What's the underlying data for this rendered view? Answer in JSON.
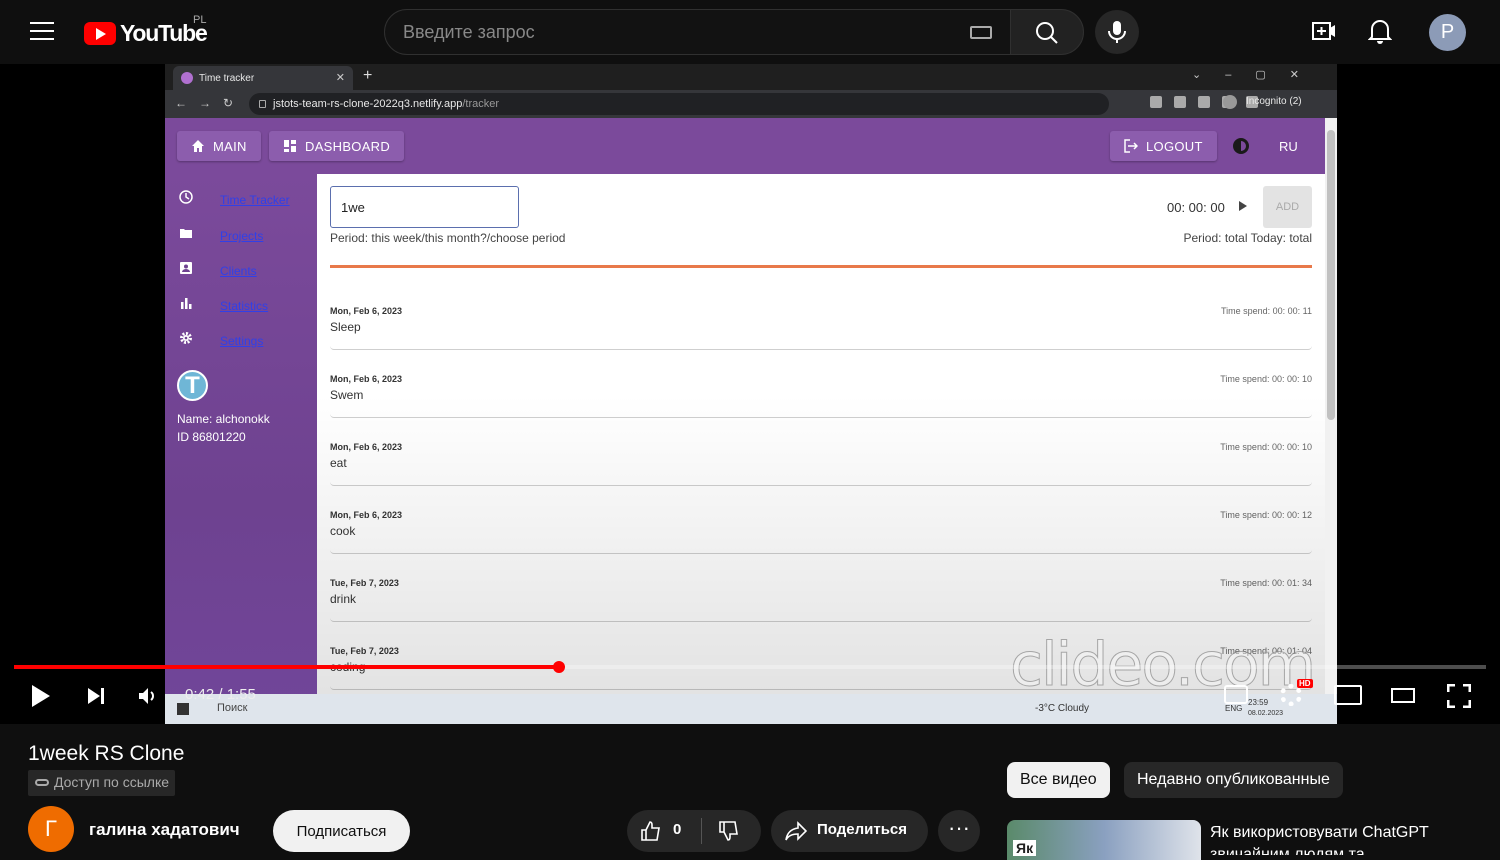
{
  "youtube": {
    "logo_text": "YouTube",
    "region": "PL",
    "search_placeholder": "Введите запрос",
    "avatar_letter": "P"
  },
  "browser": {
    "tab_title": "Time tracker",
    "tab_close": "✕",
    "new_tab": "+",
    "url_host": "jstots-team-rs-clone-2022q3.netlify.app",
    "url_path": "/tracker",
    "incognito": "Incognito (2)"
  },
  "app": {
    "nav": {
      "main": "MAIN",
      "dashboard": "DASHBOARD",
      "logout": "LOGOUT",
      "lang": "RU"
    },
    "sidebar": [
      {
        "label": "Time Tracker",
        "icon": "clock-icon"
      },
      {
        "label": "Projects",
        "icon": "folder-icon"
      },
      {
        "label": "Clients",
        "icon": "contact-icon"
      },
      {
        "label": "Statistics",
        "icon": "bar-chart-icon"
      },
      {
        "label": "Settings",
        "icon": "gear-icon"
      }
    ],
    "user": {
      "avatar_letter": "T",
      "name": "Name: alchonokk",
      "id": "ID 86801220"
    },
    "task_input_value": "1we",
    "timer": "00: 00: 00",
    "add_label": "ADD",
    "period_left": "Period: this week/this month?/choose period",
    "period_right": "Period: total  Today: total",
    "entries": [
      {
        "date": "Mon, Feb 6, 2023",
        "title": "Sleep",
        "spend": "Time spend: 00: 00: 11"
      },
      {
        "date": "Mon, Feb 6, 2023",
        "title": "Swem",
        "spend": "Time spend: 00: 00: 10"
      },
      {
        "date": "Mon, Feb 6, 2023",
        "title": "eat",
        "spend": "Time spend: 00: 00: 10"
      },
      {
        "date": "Mon, Feb 6, 2023",
        "title": "cook",
        "spend": "Time spend: 00: 00: 12"
      },
      {
        "date": "Tue, Feb 7, 2023",
        "title": "drink",
        "spend": "Time spend: 00: 01: 34"
      },
      {
        "date": "Tue, Feb 7, 2023",
        "title": "coding",
        "spend": "Time spend: 00: 01: 04"
      }
    ]
  },
  "taskbar": {
    "search": "Поиск",
    "weather": "-3°C  Cloudy",
    "lang": "ENG",
    "time": "23:59",
    "date": "08.02.2023"
  },
  "watermark": "clideo.com",
  "player": {
    "time": "0:42 / 1:55",
    "progress": 0.37,
    "hd": "HD"
  },
  "video": {
    "title": "1week RS Clone",
    "visibility": "Доступ по ссылке",
    "channel_letter": "Г",
    "channel_name": "галина хадатович",
    "subscribe": "Подписаться",
    "likes": "0",
    "share": "Поделиться",
    "more": "···"
  },
  "recommendations": {
    "chips": [
      "Все видео",
      "Недавно опубликованные"
    ],
    "first_title": "Як використовувати ChatGPT звичайним людям та",
    "first_thumb_text": "Як"
  },
  "colors": {
    "accent": "#ff0000",
    "app_purple": "#7b4a9b",
    "divider": "#e8794a",
    "link": "#3040e8"
  }
}
